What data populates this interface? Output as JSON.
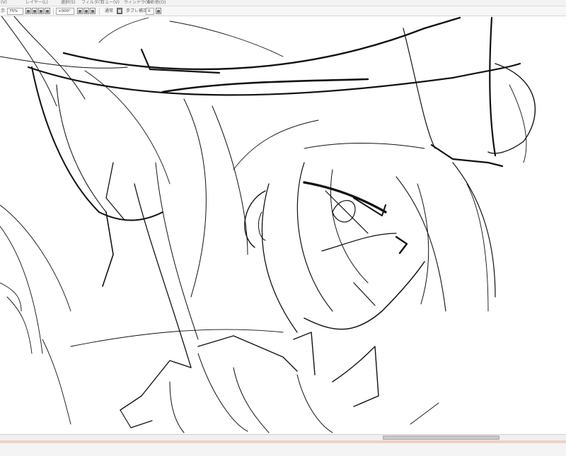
{
  "menu": {
    "items": [
      {
        "id": "partial-left",
        "label": "(V)"
      },
      {
        "id": "layer",
        "label": "レイヤー(L)"
      },
      {
        "id": "select",
        "label": "選択(S)"
      },
      {
        "id": "filter",
        "label": "フィルタ(T)"
      },
      {
        "id": "view",
        "label": "ビュー(V)"
      },
      {
        "id": "window",
        "label": "ウィンドウ(W)"
      },
      {
        "id": "other",
        "label": "その他(O)"
      }
    ]
  },
  "toolbar": {
    "view_label": "示",
    "zoom_value": "75%",
    "rotation_value": "+000°",
    "blend_mode": "通常",
    "stabilizer_label": "手ブレ補正",
    "stabilizer_value": "0"
  },
  "scrollbar": {
    "thumb_start_fraction": 0.676,
    "thumb_length_fraction": 0.206
  },
  "colors": {
    "menubar_bg": "#f3f3f3",
    "toolbar_bg": "#f7f7f7",
    "canvas_bg": "#ffffff",
    "ink": "#111111",
    "accent_line": "#e36a4d"
  }
}
